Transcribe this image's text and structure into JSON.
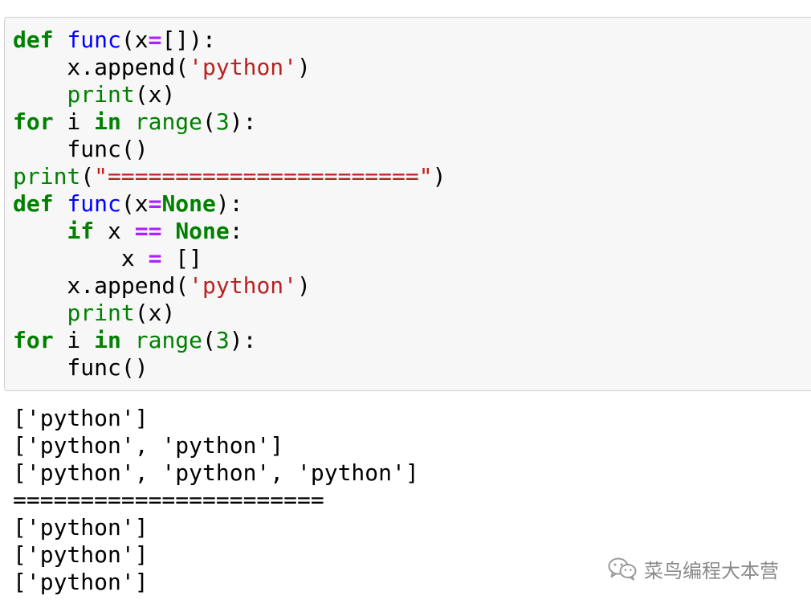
{
  "notebook": {
    "cell": {
      "code_lines": [
        [
          {
            "t": "def",
            "c": "kw"
          },
          {
            "t": " ",
            "c": "tx"
          },
          {
            "t": "func",
            "c": "fn"
          },
          {
            "t": "(x",
            "c": "tx"
          },
          {
            "t": "=",
            "c": "op"
          },
          {
            "t": "[]):",
            "c": "tx"
          }
        ],
        [
          {
            "t": "    x.append(",
            "c": "tx"
          },
          {
            "t": "'python'",
            "c": "str"
          },
          {
            "t": ")",
            "c": "tx"
          }
        ],
        [
          {
            "t": "    ",
            "c": "tx"
          },
          {
            "t": "print",
            "c": "bi"
          },
          {
            "t": "(x)",
            "c": "tx"
          }
        ],
        [
          {
            "t": "for",
            "c": "kw"
          },
          {
            "t": " i ",
            "c": "tx"
          },
          {
            "t": "in",
            "c": "kw"
          },
          {
            "t": " ",
            "c": "tx"
          },
          {
            "t": "range",
            "c": "bi"
          },
          {
            "t": "(",
            "c": "tx"
          },
          {
            "t": "3",
            "c": "num"
          },
          {
            "t": "):",
            "c": "tx"
          }
        ],
        [
          {
            "t": "    func()",
            "c": "tx"
          }
        ],
        [
          {
            "t": "print",
            "c": "bi"
          },
          {
            "t": "(",
            "c": "tx"
          },
          {
            "t": "\"=======================\"",
            "c": "str"
          },
          {
            "t": ")",
            "c": "tx"
          }
        ],
        [
          {
            "t": "def",
            "c": "kw"
          },
          {
            "t": " ",
            "c": "tx"
          },
          {
            "t": "func",
            "c": "fn"
          },
          {
            "t": "(x",
            "c": "tx"
          },
          {
            "t": "=",
            "c": "op"
          },
          {
            "t": "None",
            "c": "kw"
          },
          {
            "t": "):",
            "c": "tx"
          }
        ],
        [
          {
            "t": "    ",
            "c": "tx"
          },
          {
            "t": "if",
            "c": "kw"
          },
          {
            "t": " x ",
            "c": "tx"
          },
          {
            "t": "==",
            "c": "op"
          },
          {
            "t": " ",
            "c": "tx"
          },
          {
            "t": "None",
            "c": "kw"
          },
          {
            "t": ":",
            "c": "tx"
          }
        ],
        [
          {
            "t": "        x ",
            "c": "tx"
          },
          {
            "t": "=",
            "c": "op"
          },
          {
            "t": " []",
            "c": "tx"
          }
        ],
        [
          {
            "t": "    x.append(",
            "c": "tx"
          },
          {
            "t": "'python'",
            "c": "str"
          },
          {
            "t": ")",
            "c": "tx"
          }
        ],
        [
          {
            "t": "    ",
            "c": "tx"
          },
          {
            "t": "print",
            "c": "bi"
          },
          {
            "t": "(x)",
            "c": "tx"
          }
        ],
        [
          {
            "t": "for",
            "c": "kw"
          },
          {
            "t": " i ",
            "c": "tx"
          },
          {
            "t": "in",
            "c": "kw"
          },
          {
            "t": " ",
            "c": "tx"
          },
          {
            "t": "range",
            "c": "bi"
          },
          {
            "t": "(",
            "c": "tx"
          },
          {
            "t": "3",
            "c": "num"
          },
          {
            "t": "):",
            "c": "tx"
          }
        ],
        [
          {
            "t": "    func()",
            "c": "tx"
          }
        ]
      ],
      "output_lines": [
        "['python']",
        "['python', 'python']",
        "['python', 'python', 'python']",
        "=======================",
        "['python']",
        "['python']",
        "['python']"
      ]
    },
    "syntax_colors": {
      "keyword": "#008000",
      "operator": "#aa22ff",
      "function_name": "#0000ff",
      "builtin": "#008000",
      "string": "#ba2121",
      "number": "#008000",
      "text": "#000000"
    }
  },
  "watermark": {
    "icon": "wechat-icon",
    "text": "菜鸟编程大本营"
  }
}
